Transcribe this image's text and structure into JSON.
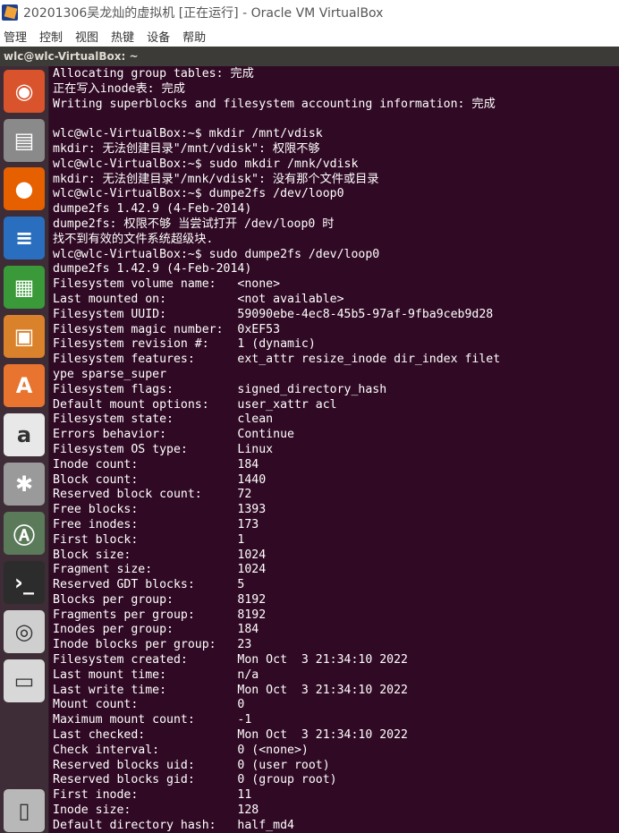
{
  "window": {
    "title": "20201306吴龙灿的虚拟机 [正在运行] - Oracle VM VirtualBox"
  },
  "menu": {
    "items": [
      "管理",
      "控制",
      "视图",
      "热键",
      "设备",
      "帮助"
    ]
  },
  "topbar": {
    "title": "wlc@wlc-VirtualBox: ~"
  },
  "launcher": {
    "items": [
      {
        "name": "ubuntu-dash-icon",
        "bg": "#d9532c",
        "glyph": "◉"
      },
      {
        "name": "files-icon",
        "bg": "#8a8a8a",
        "glyph": "▤"
      },
      {
        "name": "firefox-icon",
        "bg": "#e66000",
        "glyph": "●"
      },
      {
        "name": "writer-icon",
        "bg": "#2a6fbf",
        "glyph": "≡"
      },
      {
        "name": "calc-icon",
        "bg": "#3a9a3a",
        "glyph": "▦"
      },
      {
        "name": "impress-icon",
        "bg": "#d9822b",
        "glyph": "▣"
      },
      {
        "name": "software-center-icon",
        "bg": "#e8742f",
        "glyph": "A"
      },
      {
        "name": "amazon-icon",
        "bg": "#e8e8e8",
        "glyph": "a"
      },
      {
        "name": "system-settings-icon",
        "bg": "#9a9a9a",
        "glyph": "✱"
      },
      {
        "name": "software-updater-icon",
        "bg": "#5a7a5a",
        "glyph": "Ⓐ"
      },
      {
        "name": "terminal-icon",
        "bg": "#2c2c2c",
        "glyph": "›_"
      },
      {
        "name": "dvd-icon",
        "bg": "#cfcfcf",
        "glyph": "◎"
      },
      {
        "name": "drive-icon",
        "bg": "#d8d8d8",
        "glyph": "▭"
      },
      {
        "name": "trash-icon",
        "bg": "#b8b8b8",
        "glyph": "▯"
      }
    ]
  },
  "terminal": {
    "lines": [
      "Allocating group tables: 完成",
      "正在写入inode表: 完成",
      "Writing superblocks and filesystem accounting information: 完成",
      "",
      "wlc@wlc-VirtualBox:~$ mkdir /mnt/vdisk",
      "mkdir: 无法创建目录\"/mnt/vdisk\": 权限不够",
      "wlc@wlc-VirtualBox:~$ sudo mkdir /mnk/vdisk",
      "mkdir: 无法创建目录\"/mnk/vdisk\": 没有那个文件或目录",
      "wlc@wlc-VirtualBox:~$ dumpe2fs /dev/loop0",
      "dumpe2fs 1.42.9 (4-Feb-2014)",
      "dumpe2fs: 权限不够 当尝试打开 /dev/loop0 时",
      "找不到有效的文件系统超级块.",
      "wlc@wlc-VirtualBox:~$ sudo dumpe2fs /dev/loop0",
      "dumpe2fs 1.42.9 (4-Feb-2014)",
      "Filesystem volume name:   <none>",
      "Last mounted on:          <not available>",
      "Filesystem UUID:          59090ebe-4ec8-45b5-97af-9fba9ceb9d28",
      "Filesystem magic number:  0xEF53",
      "Filesystem revision #:    1 (dynamic)",
      "Filesystem features:      ext_attr resize_inode dir_index filet",
      "ype sparse_super",
      "Filesystem flags:         signed_directory_hash",
      "Default mount options:    user_xattr acl",
      "Filesystem state:         clean",
      "Errors behavior:          Continue",
      "Filesystem OS type:       Linux",
      "Inode count:              184",
      "Block count:              1440",
      "Reserved block count:     72",
      "Free blocks:              1393",
      "Free inodes:              173",
      "First block:              1",
      "Block size:               1024",
      "Fragment size:            1024",
      "Reserved GDT blocks:      5",
      "Blocks per group:         8192",
      "Fragments per group:      8192",
      "Inodes per group:         184",
      "Inode blocks per group:   23",
      "Filesystem created:       Mon Oct  3 21:34:10 2022",
      "Last mount time:          n/a",
      "Last write time:          Mon Oct  3 21:34:10 2022",
      "Mount count:              0",
      "Maximum mount count:      -1",
      "Last checked:             Mon Oct  3 21:34:10 2022",
      "Check interval:           0 (<none>)",
      "Reserved blocks uid:      0 (user root)",
      "Reserved blocks gid:      0 (group root)",
      "First inode:              11",
      "Inode size:               128",
      "Default directory hash:   half_md4"
    ]
  }
}
